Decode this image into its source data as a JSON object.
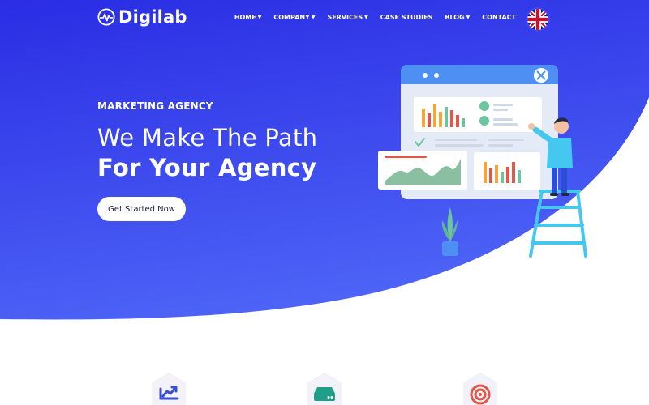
{
  "brand": {
    "name": "Digilab",
    "icon": "waveform-logo-icon"
  },
  "nav": {
    "items": [
      {
        "label": "HOME",
        "dropdown": true
      },
      {
        "label": "COMPANY",
        "dropdown": true
      },
      {
        "label": "SERVICES",
        "dropdown": true
      },
      {
        "label": "CASE STUDIES",
        "dropdown": false
      },
      {
        "label": "BLOG",
        "dropdown": true
      },
      {
        "label": "CONTACT",
        "dropdown": false
      }
    ],
    "language_icon": "uk-flag-icon"
  },
  "hero": {
    "eyebrow": "MARKETING AGENCY",
    "headline_line1": "We Make The Path",
    "headline_line2": "For Your Agency",
    "cta_label": "Get Started Now"
  },
  "features": {
    "icons": [
      "trend-chart-icon",
      "server-icon",
      "target-icon"
    ]
  },
  "colors": {
    "hero_gradient_top": "#2b2ee6",
    "hero_gradient_bottom": "#4a5cf5",
    "accent_green": "#6cc5a0",
    "accent_orange": "#f4a63b",
    "accent_red": "#e2574c",
    "accent_cyan": "#45c8ef"
  }
}
